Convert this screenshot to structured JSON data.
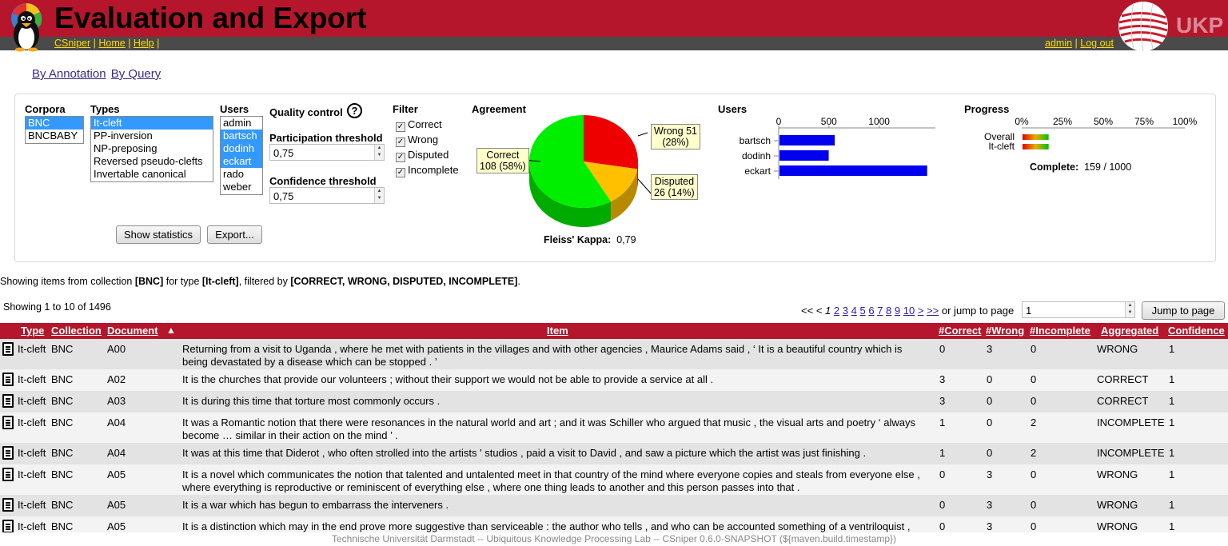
{
  "app": {
    "title": "Evaluation and Export",
    "nav_left": [
      "CSniper",
      "Home",
      "Help"
    ],
    "nav_right": [
      "admin",
      "Log out"
    ],
    "brand": "UKP"
  },
  "modes": [
    "By Annotation",
    "By Query"
  ],
  "filters": {
    "corpora_label": "Corpora",
    "corpora": [
      {
        "name": "BNC",
        "selected": true
      },
      {
        "name": "BNCBABY",
        "selected": false
      }
    ],
    "types_label": "Types",
    "types": [
      {
        "name": "It-cleft",
        "selected": true
      },
      {
        "name": "PP-inversion",
        "selected": false
      },
      {
        "name": "NP-preposing",
        "selected": false
      },
      {
        "name": "Reversed pseudo-clefts",
        "selected": false
      },
      {
        "name": "Invertable canonical",
        "selected": false
      }
    ],
    "users_label": "Users",
    "users": [
      {
        "name": "admin",
        "selected": false
      },
      {
        "name": "bartsch",
        "selected": true
      },
      {
        "name": "dodinh",
        "selected": true
      },
      {
        "name": "eckart",
        "selected": true
      },
      {
        "name": "rado",
        "selected": false
      },
      {
        "name": "weber",
        "selected": false
      }
    ],
    "quality_label": "Quality control",
    "help_glyph": "?",
    "participation_label": "Participation threshold",
    "participation_value": "0,75",
    "confidence_label": "Confidence threshold",
    "confidence_value": "0,75",
    "filter_label": "Filter",
    "filter_options": [
      {
        "label": "Correct",
        "checked": true
      },
      {
        "label": "Wrong",
        "checked": true
      },
      {
        "label": "Disputed",
        "checked": true
      },
      {
        "label": "Incomplete",
        "checked": true
      }
    ],
    "show_statistics": "Show statistics",
    "export": "Export..."
  },
  "agreement": {
    "label": "Agreement",
    "slices": [
      {
        "label": "Correct",
        "value": 108,
        "percent": 58,
        "text": "108 (58%)",
        "color": "#00ee00"
      },
      {
        "label": "Wrong",
        "value": 51,
        "percent": 28,
        "text": "Wrong 51",
        "pct_text": "(28%)",
        "color": "#ee0000"
      },
      {
        "label": "Disputed",
        "value": 26,
        "percent": 14,
        "text": "Disputed",
        "pct_text": "26 (14%)",
        "color": "#ffc000"
      }
    ],
    "kappa_label": "Fleiss' Kappa:",
    "kappa_value": "0,79"
  },
  "users_chart": {
    "label": "Users",
    "ticks": [
      "0",
      "500",
      "1000"
    ],
    "bars": [
      {
        "name": "bartsch",
        "value": 550
      },
      {
        "name": "dodinh",
        "value": 490
      },
      {
        "name": "eckart",
        "value": 1470
      }
    ],
    "xmax": 1560,
    "color": "#0000ee"
  },
  "progress": {
    "label": "Progress",
    "ticks": [
      "0%",
      "25%",
      "50%",
      "75%",
      "100%"
    ],
    "rows": [
      {
        "name": "Overall",
        "fraction": 0.16
      },
      {
        "name": "It-cleft",
        "fraction": 0.16
      }
    ],
    "complete_label": "Complete:",
    "complete_value": "159 / 1000"
  },
  "summary": {
    "prefix": "Showing items from collection ",
    "collection": "[BNC]",
    "mid": " for type ",
    "type": "[It-cleft]",
    "mid2": ", filtered by ",
    "filters": "[CORRECT, WRONG, DISPUTED, INCOMPLETE]",
    "suffix": "."
  },
  "paging": {
    "showing": "Showing 1 to 10 of 1496",
    "first": "<<",
    "prev": "<",
    "current": "1",
    "pages": [
      "2",
      "3",
      "4",
      "5",
      "6",
      "7",
      "8",
      "9",
      "10"
    ],
    "next": ">",
    "last": ">>",
    "jump_text": "or jump to page",
    "jump_value": "1",
    "jump_button": "Jump to page"
  },
  "table": {
    "headers": {
      "type": "Type",
      "collection": "Collection",
      "document": "Document",
      "sort": "▲",
      "item": "Item",
      "correct": "#Correct",
      "wrong": "#Wrong",
      "incomplete": "#Incomplete",
      "aggregated": "Aggregated",
      "confidence": "Confidence"
    },
    "rows": [
      {
        "type": "It-cleft",
        "collection": "BNC",
        "document": "A00",
        "item": "Returning from a visit to Uganda , where he met with patients in the villages and with other agencies , Maurice Adams said , ‘ It is a beautiful country which is being devastated by a disease which can be stopped . ’",
        "correct": "0",
        "wrong": "3",
        "incomplete": "0",
        "aggregated": "WRONG",
        "confidence": "1"
      },
      {
        "type": "It-cleft",
        "collection": "BNC",
        "document": "A02",
        "item": "It is the churches that provide our volunteers ; without their support we would not be able to provide a service at all .",
        "correct": "3",
        "wrong": "0",
        "incomplete": "0",
        "aggregated": "CORRECT",
        "confidence": "1"
      },
      {
        "type": "It-cleft",
        "collection": "BNC",
        "document": "A03",
        "item": "It is during this time that torture most commonly occurs .",
        "correct": "3",
        "wrong": "0",
        "incomplete": "0",
        "aggregated": "CORRECT",
        "confidence": "1"
      },
      {
        "type": "It-cleft",
        "collection": "BNC",
        "document": "A04",
        "item": "It was a Romantic notion that there were resonances in the natural world and art ; and it was Schiller who argued that music , the visual arts and poetry ‘ always become … similar in their action on the mind ’ .",
        "correct": "1",
        "wrong": "0",
        "incomplete": "2",
        "aggregated": "INCOMPLETE",
        "confidence": "1"
      },
      {
        "type": "It-cleft",
        "collection": "BNC",
        "document": "A04",
        "item": "It was at this time that Diderot , who often strolled into the artists ' studios , paid a visit to David , and saw a picture which the artist was just finishing .",
        "correct": "1",
        "wrong": "0",
        "incomplete": "2",
        "aggregated": "INCOMPLETE",
        "confidence": "1"
      },
      {
        "type": "It-cleft",
        "collection": "BNC",
        "document": "A05",
        "item": "It is a novel which communicates the notion that talented and untalented meet in that country of the mind where everyone copies and steals from everyone else , where everything is reproductive or reminiscent of everything else , where one thing leads to another and this person passes into that .",
        "correct": "0",
        "wrong": "3",
        "incomplete": "0",
        "aggregated": "WRONG",
        "confidence": "1"
      },
      {
        "type": "It-cleft",
        "collection": "BNC",
        "document": "A05",
        "item": "It is a war which has begun to embarrass the interveners .",
        "correct": "0",
        "wrong": "3",
        "incomplete": "0",
        "aggregated": "WRONG",
        "confidence": "1"
      },
      {
        "type": "It-cleft",
        "collection": "BNC",
        "document": "A05",
        "item": "It is a distinction which may in the end prove more suggestive than serviceable : the author who tells , and who can be accounted something of a ventriloquist ,",
        "correct": "0",
        "wrong": "3",
        "incomplete": "0",
        "aggregated": "WRONG",
        "confidence": "1"
      }
    ]
  },
  "footer": "Technische Universität Darmstadt -- Ubiquitous Knowledge Processing Lab -- CSniper 0.6.0-SNAPSHOT (${maven.build.timestamp})"
}
